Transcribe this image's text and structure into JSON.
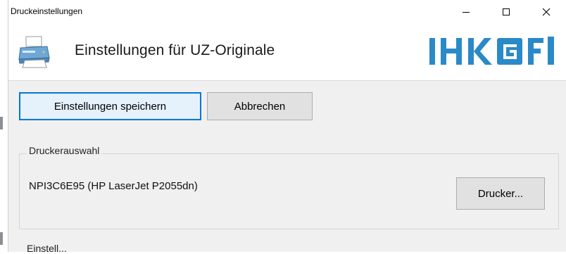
{
  "window": {
    "title": "Druckeinstellungen",
    "controls": {
      "minimize": "—",
      "maximize": "☐",
      "close": "✕"
    }
  },
  "header": {
    "title": "Einstellungen für UZ-Originale",
    "icon": "printer-icon",
    "logo": {
      "text": "IHKGfI",
      "color": "#2a8ac8"
    }
  },
  "toolbar": {
    "save_label": "Einstellungen speichern",
    "cancel_label": "Abbrechen"
  },
  "printer_selection": {
    "legend": "Druckerauswahl",
    "printer_name": "NPI3C6E95 (HP LaserJet P2055dn)",
    "printer_button_label": "Drucker..."
  },
  "next_section": {
    "legend": "Einstell..."
  },
  "colors": {
    "accent": "#0078d7",
    "window_bg": "#f0f0f0",
    "logo_blue": "#2a8ac8"
  }
}
